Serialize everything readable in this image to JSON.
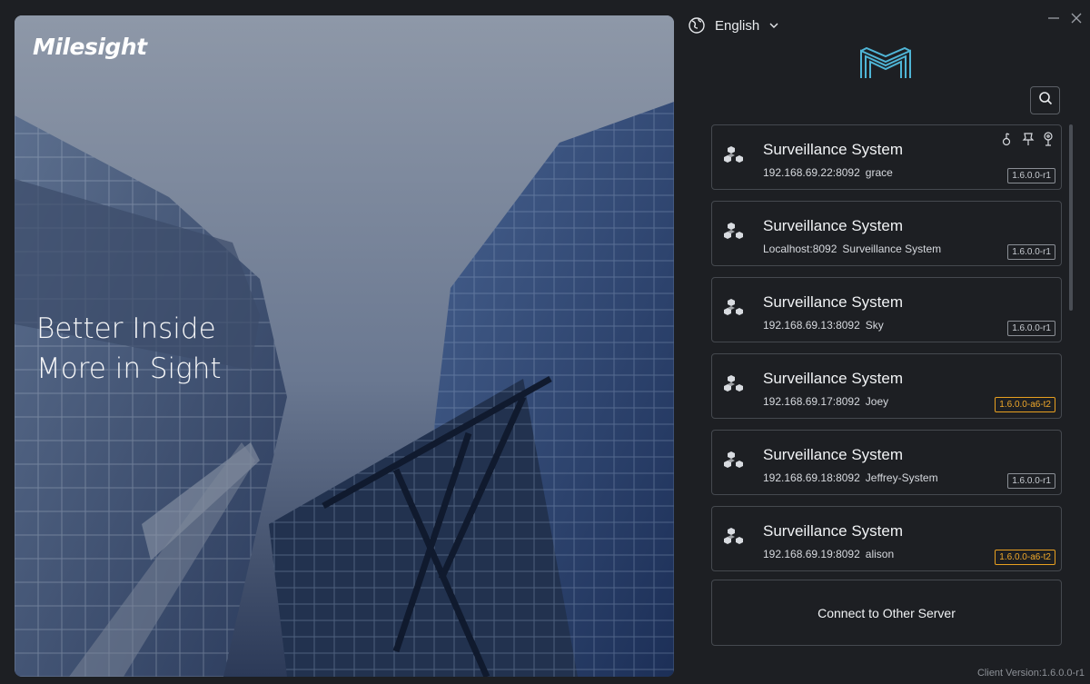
{
  "hero": {
    "brand": "Milesight",
    "tagline_line1": "Better Inside",
    "tagline_line2": "More in Sight"
  },
  "header": {
    "language": "English",
    "icons": [
      "globe-icon",
      "chevron-down-icon",
      "minimize-icon",
      "close-icon",
      "milesight-logo",
      "search-icon"
    ]
  },
  "servers": [
    {
      "name": "Surveillance System",
      "address": "192.168.69.22:8092",
      "user": "grace",
      "version": "1.6.0.0-r1",
      "version_warning": false,
      "active_icons": [
        "touch-icon",
        "pin-icon",
        "remote-icon"
      ]
    },
    {
      "name": "Surveillance System",
      "address": "Localhost:8092",
      "user": "Surveillance System",
      "version": "1.6.0.0-r1",
      "version_warning": false
    },
    {
      "name": "Surveillance System",
      "address": "192.168.69.13:8092",
      "user": "Sky",
      "version": "1.6.0.0-r1",
      "version_warning": false
    },
    {
      "name": "Surveillance System",
      "address": "192.168.69.17:8092",
      "user": "Joey",
      "version": "1.6.0.0-a6-t2",
      "version_warning": true
    },
    {
      "name": "Surveillance System",
      "address": "192.168.69.18:8092",
      "user": "Jeffrey-System",
      "version": "1.6.0.0-r1",
      "version_warning": false
    },
    {
      "name": "Surveillance System",
      "address": "192.168.69.19:8092",
      "user": "alison",
      "version": "1.6.0.0-a6-t2",
      "version_warning": true
    }
  ],
  "connect_other_label": "Connect to Other Server",
  "client_version": "Client Version:1.6.0.0-r1",
  "colors": {
    "background": "#1d1f23",
    "card_border": "#45494f",
    "warning": "#e8a020",
    "logo": "#4fb5d6"
  }
}
